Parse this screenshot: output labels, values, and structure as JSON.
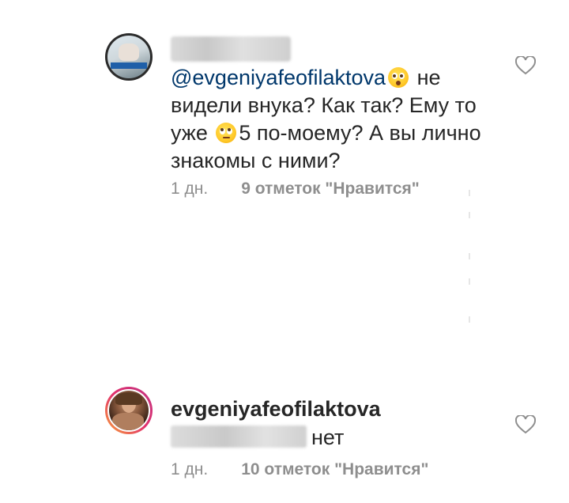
{
  "comments": [
    {
      "mention": "@evgeniyafeofilaktova",
      "text_part1": " не видели внука?  Как так? Ему то уже ",
      "text_part2": "5 по-моему? А вы лично знакомы с ними?",
      "emoji_1": "flushed-face",
      "emoji_2": "face-with-rolling-eyes",
      "time": "1 дн.",
      "likes": "9 отметок \"Нравится\""
    },
    {
      "username": "evgeniyafeofilaktova",
      "reply_text": "нет",
      "time": "1 дн.",
      "likes": "10 отметок \"Нравится\""
    }
  ],
  "colors": {
    "text": "#262626",
    "mention": "#00376b",
    "meta": "#8e8e8e"
  }
}
